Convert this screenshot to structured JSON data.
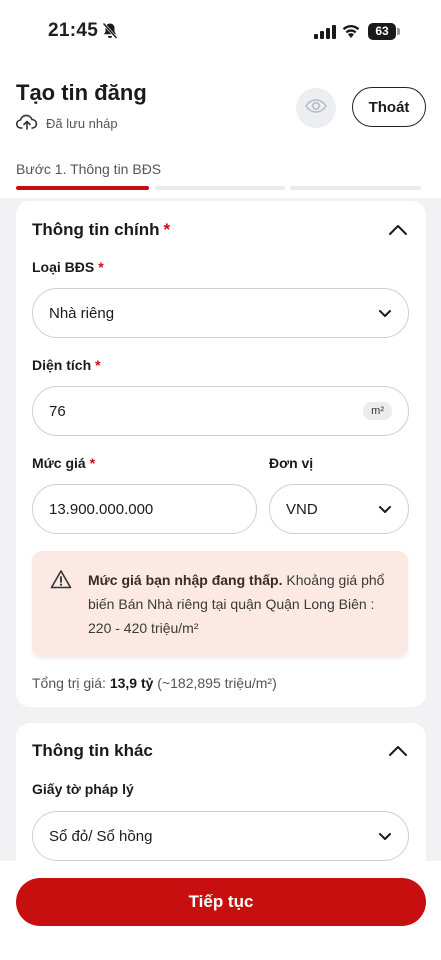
{
  "status_bar": {
    "time": "21:45",
    "battery": "63"
  },
  "header": {
    "title": "Tạo tin đăng",
    "draft_status": "Đã lưu nháp",
    "exit_label": "Thoát"
  },
  "step": {
    "label": "Bước 1. Thông tin BĐS",
    "current": 1,
    "total": 3
  },
  "main_info": {
    "title": "Thông tin chính",
    "required_mark": "*",
    "property_type": {
      "label": "Loại BĐS",
      "value": "Nhà riêng"
    },
    "area": {
      "label": "Diện tích",
      "value": "76",
      "unit": "m²"
    },
    "price": {
      "label": "Mức giá",
      "value": "13.900.000.000"
    },
    "currency": {
      "label": "Đơn vị",
      "value": "VND"
    },
    "warning": {
      "bold": "Mức giá bạn nhập đang thấp.",
      "text": " Khoảng giá phổ biến Bán Nhà riêng tại quận Quận Long Biên : 220 - 420 triệu/m²"
    },
    "total": {
      "prefix": "Tổng trị giá: ",
      "value": "13,9 tỷ",
      "suffix": " (~182,895 triệu/m²)"
    }
  },
  "other_info": {
    "title": "Thông tin khác",
    "legal": {
      "label": "Giấy tờ pháp lý",
      "value": "Sổ đỏ/ Sổ hồng"
    }
  },
  "footer": {
    "continue_label": "Tiếp tục"
  },
  "colors": {
    "accent": "#c80f0f",
    "warning_bg": "#fde9e3"
  }
}
